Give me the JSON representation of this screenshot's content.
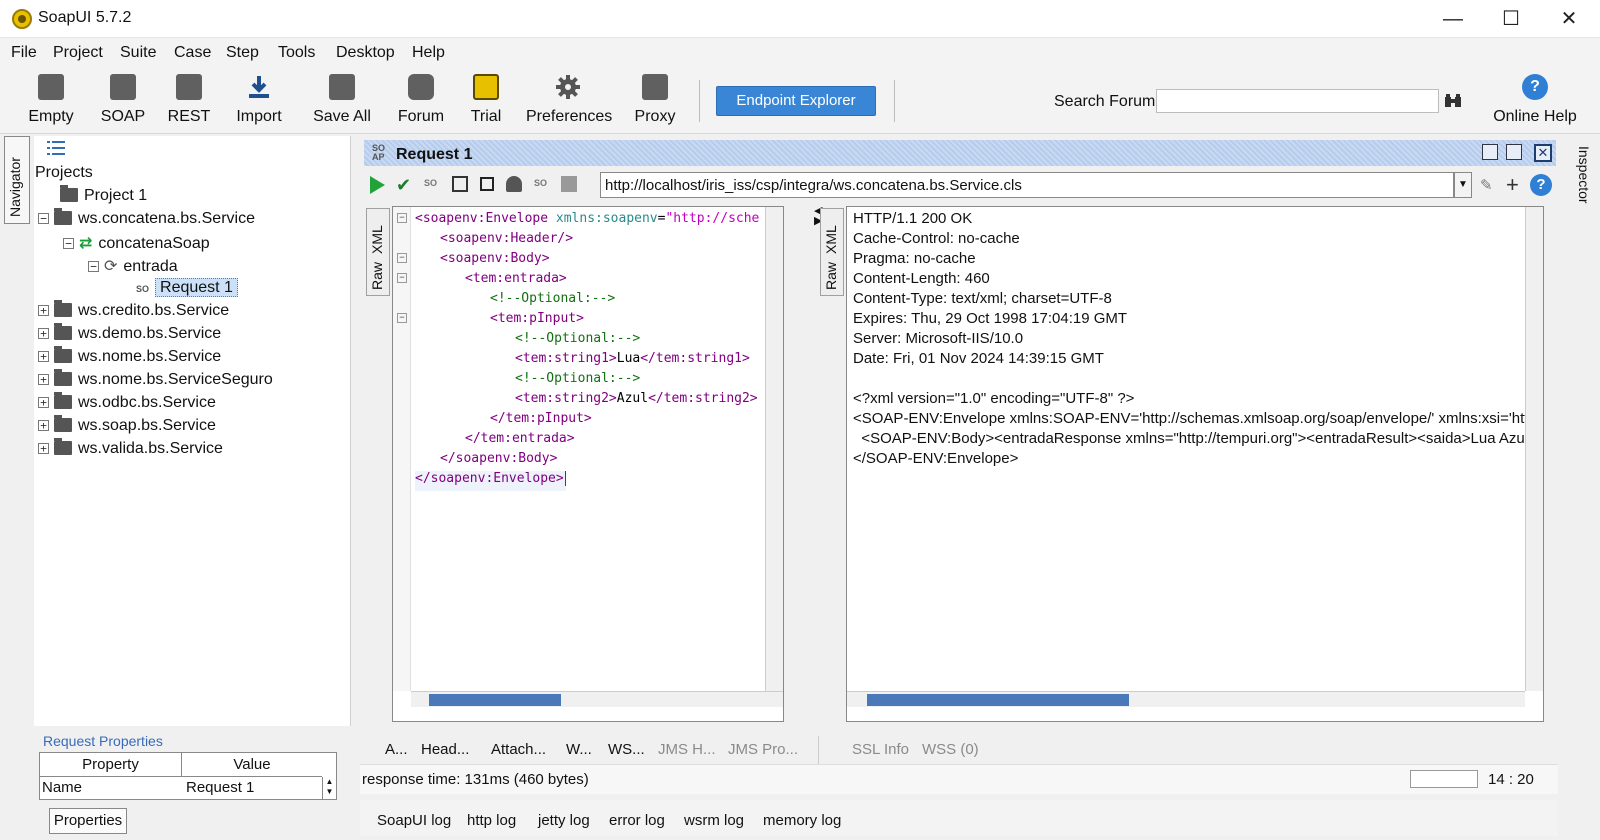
{
  "window": {
    "title": "SoapUI 5.7.2",
    "minimize": "—",
    "maximize": "☐",
    "close": "✕"
  },
  "menu": [
    "File",
    "Project",
    "Suite",
    "Case",
    "Step",
    "Tools",
    "Desktop",
    "Help"
  ],
  "toolbar": {
    "buttons": [
      "Empty",
      "SOAP",
      "REST",
      "Import",
      "Save All",
      "Forum",
      "Trial",
      "Preferences",
      "Proxy"
    ],
    "endpoint_explorer": "Endpoint Explorer",
    "search_label": "Search Forum",
    "search_value": "",
    "online_help": "Online Help"
  },
  "navigator": {
    "rail_label": "Navigator",
    "root": "Projects",
    "tree": [
      "Project 1",
      "ws.concatena.bs.Service",
      "concatenaSoap",
      "entrada",
      "Request 1",
      "ws.credito.bs.Service",
      "ws.demo.bs.Service",
      "ws.nome.bs.Service",
      "ws.nome.bs.ServiceSeguro",
      "ws.odbc.bs.Service",
      "ws.soap.bs.Service",
      "ws.valida.bs.Service"
    ],
    "request_properties_label": "Request Properties",
    "props_header": [
      "Property",
      "Value"
    ],
    "props_row": [
      "Name",
      "Request 1"
    ],
    "properties_button": "Properties"
  },
  "request": {
    "title": "Request 1",
    "url": "http://localhost/iris_iss/csp/integra/ws.concatena.bs.Service.cls",
    "side_tabs": [
      "XML",
      "Raw"
    ],
    "xml_lines": [
      {
        "indent": 0,
        "parts": [
          [
            "tag",
            "<soapenv:Envelope "
          ],
          [
            "attr",
            "xmlns:soapenv"
          ],
          [
            "txt",
            "="
          ],
          [
            "str",
            "\"http://sche"
          ]
        ]
      },
      {
        "indent": 1,
        "parts": [
          [
            "tag",
            "<soapenv:Header/>"
          ]
        ]
      },
      {
        "indent": 1,
        "parts": [
          [
            "tag",
            "<soapenv:Body>"
          ]
        ]
      },
      {
        "indent": 2,
        "parts": [
          [
            "tag",
            "<tem:entrada>"
          ]
        ]
      },
      {
        "indent": 3,
        "parts": [
          [
            "cmt",
            "<!--Optional:-->"
          ]
        ]
      },
      {
        "indent": 3,
        "parts": [
          [
            "tag",
            "<tem:pInput>"
          ]
        ]
      },
      {
        "indent": 4,
        "parts": [
          [
            "cmt",
            "<!--Optional:-->"
          ]
        ]
      },
      {
        "indent": 4,
        "parts": [
          [
            "tag",
            "<tem:string1>"
          ],
          [
            "txt",
            "Lua"
          ],
          [
            "tag",
            "</tem:string1>"
          ]
        ]
      },
      {
        "indent": 4,
        "parts": [
          [
            "cmt",
            "<!--Optional:-->"
          ]
        ]
      },
      {
        "indent": 4,
        "parts": [
          [
            "tag",
            "<tem:string2>"
          ],
          [
            "txt",
            "Azul"
          ],
          [
            "tag",
            "</tem:string2>"
          ]
        ]
      },
      {
        "indent": 3,
        "parts": [
          [
            "tag",
            "</tem:pInput>"
          ]
        ]
      },
      {
        "indent": 2,
        "parts": [
          [
            "tag",
            "</tem:entrada>"
          ]
        ]
      },
      {
        "indent": 1,
        "parts": [
          [
            "tag",
            "</soapenv:Body>"
          ]
        ]
      },
      {
        "indent": 0,
        "parts": [
          [
            "tag",
            "</soapenv:Envelope>"
          ]
        ]
      }
    ],
    "bottom_tabs": [
      "A...",
      "Head...",
      "Attach...",
      "W...",
      "WS...",
      "JMS H...",
      "JMS Pro..."
    ]
  },
  "response": {
    "lines": [
      "HTTP/1.1 200 OK",
      "Cache-Control: no-cache",
      "Pragma: no-cache",
      "Content-Length: 460",
      "Content-Type: text/xml; charset=UTF-8",
      "Expires: Thu, 29 Oct 1998 17:04:19 GMT",
      "Server: Microsoft-IIS/10.0",
      "Date: Fri, 01 Nov 2024 14:39:15 GMT",
      "",
      "<?xml version=\"1.0\" encoding=\"UTF-8\" ?>",
      "<SOAP-ENV:Envelope xmlns:SOAP-ENV='http://schemas.xmlsoap.org/soap/envelope/' xmlns:xsi='http",
      "  <SOAP-ENV:Body><entradaResponse xmlns=\"http://tempuri.org\"><entradaResult><saida>Lua Azul",
      "</SOAP-ENV:Envelope>"
    ],
    "bottom_tabs": [
      "SSL Info",
      "WSS (0)"
    ]
  },
  "status": {
    "response_time": "response time: 131ms (460 bytes)",
    "position": "14 : 20"
  },
  "log_tabs": [
    "SoapUI log",
    "http log",
    "jetty log",
    "error log",
    "wsrm log",
    "memory log"
  ],
  "inspector_label": "Inspector"
}
